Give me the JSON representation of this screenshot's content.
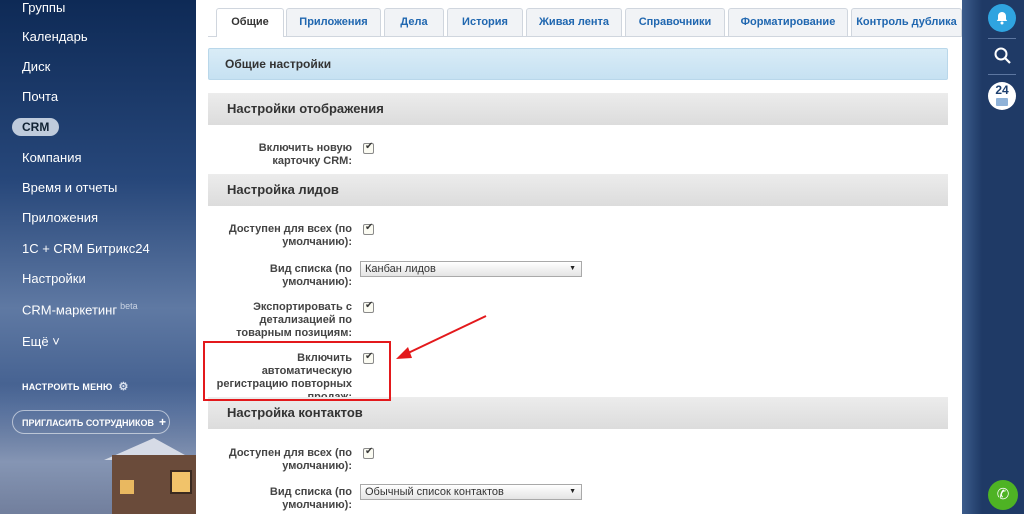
{
  "sidebar": {
    "items": [
      {
        "label": "Группы"
      },
      {
        "label": "Календарь"
      },
      {
        "label": "Диск"
      },
      {
        "label": "Почта"
      },
      {
        "label": "CRM"
      },
      {
        "label": "Компания"
      },
      {
        "label": "Время и отчеты"
      },
      {
        "label": "Приложения"
      },
      {
        "label": "1С + CRM Битрикс24"
      },
      {
        "label": "Настройки"
      },
      {
        "label": "CRM-маркетинг",
        "badge": "beta"
      },
      {
        "label": "Ещё ˅"
      }
    ],
    "configure_menu": "НАСТРОИТЬ МЕНЮ",
    "invite_button": "ПРИГЛАСИТЬ СОТРУДНИКОВ"
  },
  "rightbar": {
    "b24_label": "24"
  },
  "tabs": [
    {
      "label": "Общие",
      "active": true
    },
    {
      "label": "Приложения"
    },
    {
      "label": "Дела"
    },
    {
      "label": "История"
    },
    {
      "label": "Живая лента"
    },
    {
      "label": "Справочники"
    },
    {
      "label": "Форматирование"
    },
    {
      "label": "Контроль дублика"
    }
  ],
  "page": {
    "main_section": "Общие настройки",
    "sections": {
      "display": "Настройки отображения",
      "leads": "Настройка лидов",
      "contacts": "Настройка контактов"
    },
    "fields": {
      "new_card": {
        "label": "Включить новую карточку CRM:",
        "checked": true
      },
      "leads_available": {
        "label": "Доступен для всех (по умолчанию):",
        "checked": true
      },
      "leads_view": {
        "label": "Вид списка (по умолчанию):",
        "value": "Канбан лидов"
      },
      "export_detail": {
        "label": "Экспортировать с детализацией по товарным позициям:",
        "checked": true
      },
      "auto_repeat": {
        "label": "Включить автоматическую регистрацию повторных продаж:",
        "checked": true
      },
      "contacts_available": {
        "label": "Доступен для всех (по умолчанию):",
        "checked": true
      },
      "contacts_view": {
        "label": "Вид списка (по умолчанию):",
        "value": "Обычный список контактов"
      }
    }
  },
  "colors": {
    "highlight": "#e3191c",
    "tab_link": "#2067b0",
    "bell": "#2fa4e0",
    "phone": "#4eb324"
  }
}
